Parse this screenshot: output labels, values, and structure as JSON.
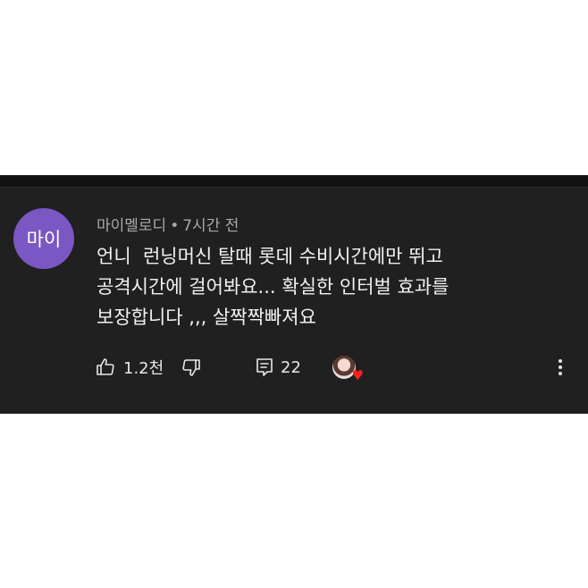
{
  "comment": {
    "avatar_text": "마이",
    "author": "마이멜로디",
    "separator": "•",
    "time": "7시간 전",
    "text": "언니  런닝머신 탈때 롯데 수비시간에만 뛰고\n공격시간에 걸어봐요... 확실한 인터벌 효과를\n보장합니다 ,,, 살짝짝빠져요",
    "like_count": "1.2천",
    "reply_count": "22"
  },
  "icons": {
    "like": "thumbs-up-icon",
    "dislike": "thumbs-down-icon",
    "reply": "reply-icon",
    "creator_heart": "heart-icon",
    "more": "more-vertical-icon"
  },
  "colors": {
    "card_background": "#202020",
    "avatar_background": "#7b57c4",
    "heart": "#ff1e1e"
  }
}
